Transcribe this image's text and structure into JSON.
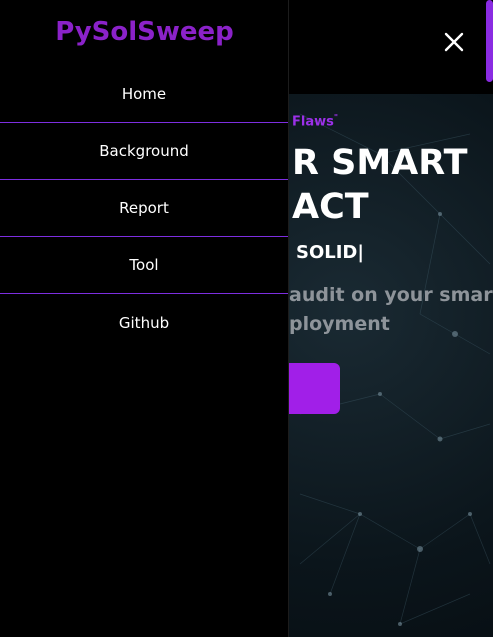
{
  "brand": "PySolSweep",
  "nav": {
    "items": [
      {
        "label": "Home"
      },
      {
        "label": "Background"
      },
      {
        "label": "Report"
      },
      {
        "label": "Tool"
      },
      {
        "label": "Github"
      }
    ]
  },
  "topbar": {
    "close_icon": "close-icon"
  },
  "hero": {
    "tagline": "Flaws",
    "title_line1": "R SMART",
    "title_line2": "ACT",
    "typed_text": "SOLID|",
    "desc_line1": "audit on your smart",
    "desc_line2": "ployment"
  },
  "colors": {
    "accent": "#a11fe8",
    "brand": "#8b22c9",
    "divider": "#7d2ee0",
    "background": "#000000"
  }
}
